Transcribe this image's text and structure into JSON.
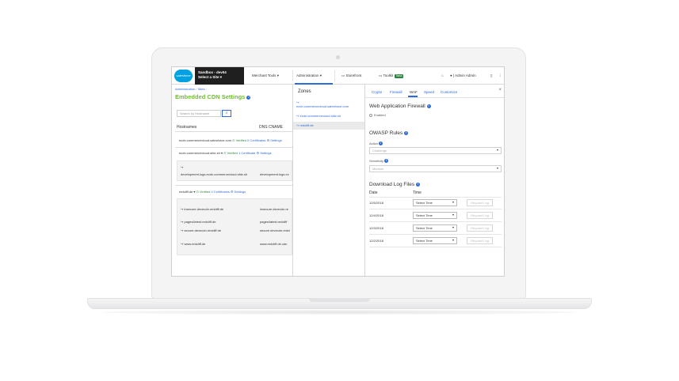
{
  "topbar": {
    "logo_text": "salesforce",
    "sandbox_line1": "Sandbox - dev04",
    "sandbox_line2": "Select a Site",
    "nav_merchant_tools": "Merchant Tools",
    "nav_administration": "Administration",
    "nav_storefront": "Storefront",
    "nav_toolkit": "Toolkit",
    "toolkit_badge": "Beta",
    "user_admin": "Admin",
    "user_admin2": "Admin"
  },
  "left": {
    "breadcrumb_admin": "Administration",
    "breadcrumb_sep1": "/",
    "breadcrumb_sites": "Sites",
    "breadcrumb_sep2": "/",
    "title": "Embedded CDN Settings",
    "search_placeholder": "Search by Hostname",
    "col_hostnames": "Hostnames",
    "col_dns": "DNS CNAME",
    "rows": [
      {
        "host": "ecdn.commercecloud.salesforce.com",
        "verified": "Verified",
        "certs": "0 Certificates",
        "settings": "Settings"
      },
      {
        "host": "ecdn.commercecloud.sfdc.sh",
        "verified": "Verified",
        "certs": "1 Certificate",
        "settings": "Settings"
      },
      {
        "host": "redcliff.de",
        "verified": "Verified",
        "certs": "0 Certificates",
        "settings": "Settings"
      }
    ],
    "sub1_host": "development.logs.ecdn.commercecloud.sfdc.sh",
    "sub1_dns": "development.logs.ec",
    "sub2": [
      {
        "host": "insecure.devecdn.redcliff.de",
        "dns": "insecure.devecdn.re"
      },
      {
        "host": "pages/latest.redcliff.de",
        "dns": "pages/latest.redcliff"
      },
      {
        "host": "secure.devecdn.redcliff.de",
        "dns": "secure.devecdn.redcl"
      },
      {
        "host": "www.redcliff.de",
        "dns": "www.redcliff.de.cdn"
      }
    ]
  },
  "zones": {
    "title": "Zones",
    "items": [
      "ecdn.commercecloud.salesforce.com",
      "ecdn.commercecloud.sfdc.sh",
      "redcliff.de"
    ]
  },
  "right": {
    "tabs": [
      "Crypto",
      "Firewall",
      "WAF",
      "Speed",
      "Customize"
    ],
    "active_tab": "WAF",
    "waf_title": "Web Application Firewall",
    "enabled_label": "Enabled",
    "owasp_title": "OWASP Rules",
    "action_label": "Action",
    "action_value": "Challenge",
    "sensitivity_label": "Sensitivity",
    "sensitivity_value": "Medium",
    "download_title": "Download Log Files",
    "col_date": "Date",
    "col_time": "Time",
    "logs": [
      {
        "date": "12/5/2018",
        "time": "Select Time",
        "button": "Request Log"
      },
      {
        "date": "12/4/2018",
        "time": "Select Time",
        "button": "Request Log"
      },
      {
        "date": "12/3/2018",
        "time": "Select Time",
        "button": "Request Log"
      },
      {
        "date": "12/2/2018",
        "time": "Select Time",
        "button": "Request Log"
      }
    ]
  },
  "colors": {
    "accent_blue": "#2e6ad8",
    "title_green": "#6fbf2e",
    "verified_green": "#2e8540",
    "brand_blue": "#00a1e0"
  }
}
